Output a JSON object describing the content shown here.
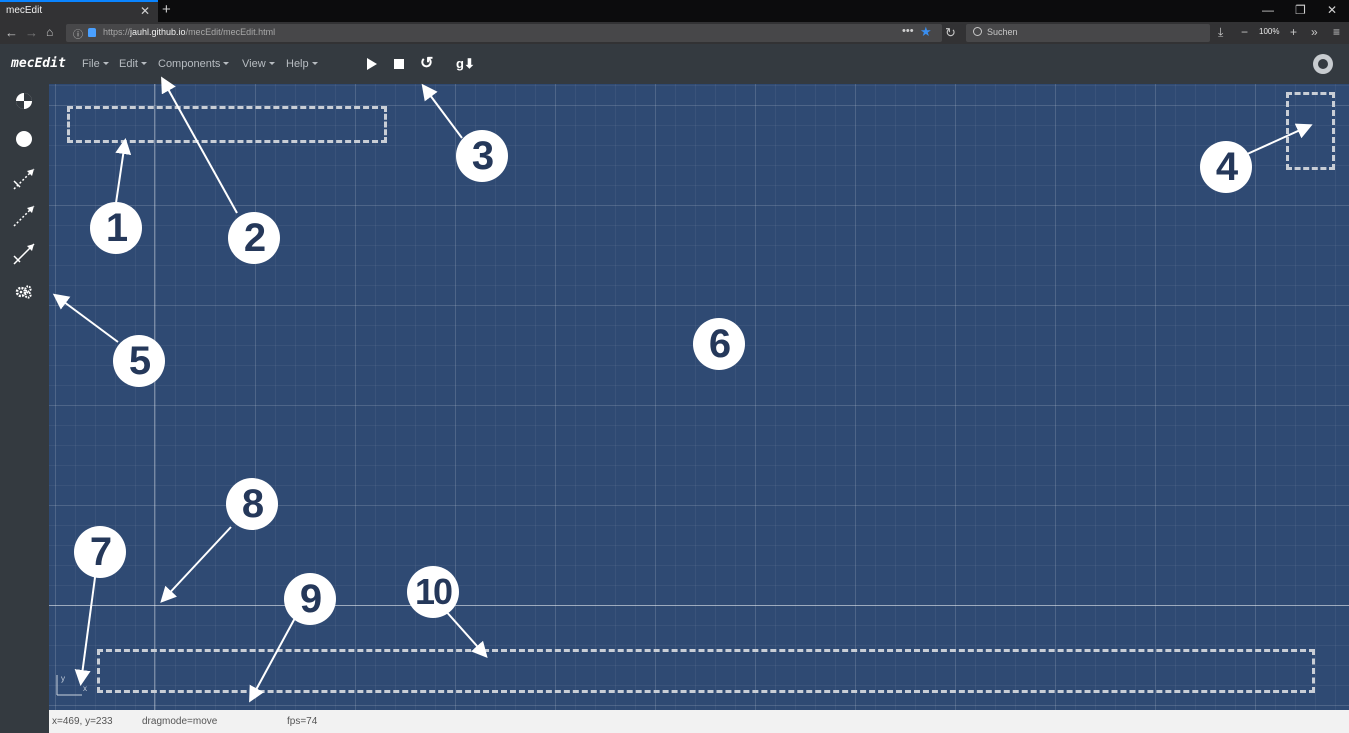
{
  "browser": {
    "tab_title": "mecEdit",
    "tab_close": "✕",
    "new_tab": "+",
    "win_minimize": "—",
    "win_restore": "❐",
    "win_close": "✕",
    "url_prefix": "https://",
    "url_host": "jauhl.github.io",
    "url_path": "/mecEdit/mecEdit.html",
    "page_actions": "•••",
    "search_placeholder": "Suchen",
    "zoom": "100%"
  },
  "app": {
    "brand": "mecEdit",
    "menus": [
      "File",
      "Edit",
      "Components",
      "View",
      "Help"
    ],
    "gravity_label": "g⬇"
  },
  "sidebar": {
    "tools": [
      "add-node-icon",
      "add-circle-node-icon",
      "add-constraint-free-icon",
      "add-constraint-tran-icon",
      "add-constraint-rot-icon",
      "drive-settings-icon"
    ]
  },
  "status": {
    "coords": "x=469, y=233",
    "dragmode": "dragmode=move",
    "fps": "fps=74"
  },
  "canvas": {
    "axis_y": "y",
    "axis_x": "x"
  },
  "callouts": [
    "1",
    "2",
    "3",
    "4",
    "5",
    "6",
    "7",
    "8",
    "9",
    "10"
  ],
  "colors": {
    "canvas_bg": "#2f4a73",
    "appbar_bg": "#343a40",
    "callout_fg": "#25385a",
    "accent": "#0a84ff"
  }
}
